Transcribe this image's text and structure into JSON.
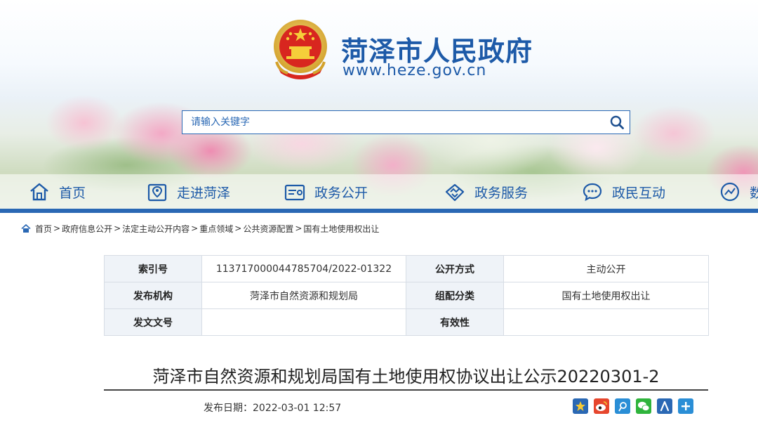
{
  "header": {
    "site_title": "菏泽市人民政府",
    "site_url": "www.heze.gov.cn"
  },
  "search": {
    "placeholder": "请输入关键字",
    "value": ""
  },
  "nav": {
    "items": [
      {
        "label": "首页",
        "icon": "home-icon"
      },
      {
        "label": "走进菏泽",
        "icon": "map-pin-icon"
      },
      {
        "label": "政务公开",
        "icon": "open-government-icon"
      },
      {
        "label": "政务服务",
        "icon": "handshake-icon"
      },
      {
        "label": "政民互动",
        "icon": "chat-icon"
      },
      {
        "label": "数",
        "icon": "data-icon"
      }
    ]
  },
  "breadcrumb": {
    "items": [
      "首页",
      "政府信息公开",
      "法定主动公开内容",
      "重点领域",
      "公共资源配置",
      "国有土地使用权出让"
    ],
    "separator": ">"
  },
  "info_table": {
    "rows": [
      {
        "label1": "索引号",
        "value1": "11371700004478570​4/2022-01322",
        "label2": "公开方式",
        "value2": "主动公开"
      },
      {
        "label1": "发布机构",
        "value1": "菏泽市自然资源和规划局",
        "label2": "组配分类",
        "value2": "国有土地使用权出让"
      },
      {
        "label1": "发文文号",
        "value1": "",
        "label2": "有效性",
        "value2": ""
      }
    ]
  },
  "article": {
    "title": "菏泽市自然资源和规划局国有土地使用权协议出让公示20220301-2",
    "publish_label": "发布日期：",
    "publish_date": "2022-03-01 12:57"
  },
  "share": {
    "icons": [
      "favorite-icon",
      "weibo-icon",
      "tencent-weibo-icon",
      "wechat-icon",
      "renren-icon",
      "more-share-icon"
    ]
  },
  "colors": {
    "brand_blue": "#1d5aa8",
    "nav_bar": "#2a68b4",
    "table_label_bg": "#eff3f8"
  }
}
